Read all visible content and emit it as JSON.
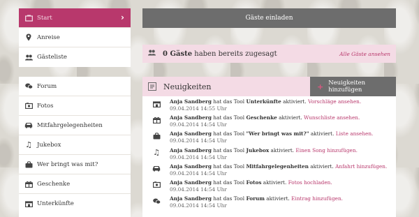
{
  "sidebar_top": [
    {
      "label": "Start",
      "icon": "home-icon",
      "active": true
    },
    {
      "label": "Anreise",
      "icon": "map-pin-icon"
    },
    {
      "label": "Gästeliste",
      "icon": "guests-icon"
    }
  ],
  "sidebar_tools": [
    {
      "label": "Forum",
      "icon": "forum-icon",
      "glyph": "💬"
    },
    {
      "label": "Fotos",
      "icon": "photo-icon",
      "glyph": "▭"
    },
    {
      "label": "Mitfahrgelegenheiten",
      "icon": "car-icon",
      "glyph": "🚗"
    },
    {
      "label": "Jukebox",
      "icon": "music-note-icon",
      "glyph": "♫"
    },
    {
      "label": "Wer bringt was mit?",
      "icon": "bag-icon",
      "glyph": "👜"
    },
    {
      "label": "Geschenke",
      "icon": "gift-icon",
      "glyph": "🎁"
    },
    {
      "label": "Unterkünfte",
      "icon": "house-icon",
      "glyph": "⌂"
    }
  ],
  "invite": {
    "label": "Gäste einladen"
  },
  "guests": {
    "count": "0 Gäste",
    "text": " haben bereits zugesagt",
    "link": "Alle Gäste ansehen"
  },
  "news": {
    "title": "Neuigkeiten",
    "add_label": "Neuigkeiten hinzufügen",
    "items": [
      {
        "icon": "house-icon",
        "glyph": "⌂",
        "user": "Anja Sandberg",
        "pre": " hat das Tool ",
        "tool": "Unterkünfte",
        "post": " aktiviert. ",
        "link": "Vorschläge ansehen.",
        "time": "09.04.2014 14:55 Uhr"
      },
      {
        "icon": "gift-icon",
        "glyph": "🎁",
        "user": "Anja Sandberg",
        "pre": " hat das Tool ",
        "tool": "Geschenke",
        "post": " aktiviert. ",
        "link": "Wunschliste ansehen.",
        "time": "09.04.2014 14:54 Uhr"
      },
      {
        "icon": "bag-icon",
        "glyph": "👜",
        "user": "Anja Sandberg",
        "pre": " hat das Tool ",
        "tool": "\"Wer bringt was mit?\"",
        "post": " aktiviert. ",
        "link": "Liste ansehen.",
        "time": "09.04.2014 14:54 Uhr"
      },
      {
        "icon": "music-note-icon",
        "glyph": "♫",
        "user": "Anja Sandberg",
        "pre": " hat das Tool ",
        "tool": "Jukebox",
        "post": " aktiviert. ",
        "link": "Einen Song hinzufügen.",
        "time": "09.04.2014 14:54 Uhr"
      },
      {
        "icon": "car-icon",
        "glyph": "🚗",
        "user": "Anja Sandberg",
        "pre": " hat das Tool ",
        "tool": "Mitfahrgelegenheiten",
        "post": " aktiviert. ",
        "link": "Anfahrt hinzufügen.",
        "time": "09.04.2014 14:54 Uhr"
      },
      {
        "icon": "photo-icon",
        "glyph": "▭",
        "user": "Anja Sandberg",
        "pre": " hat das Tool ",
        "tool": "Fotos",
        "post": " aktiviert. ",
        "link": "Fotos hochladen.",
        "time": "09.04.2014 14:54 Uhr"
      },
      {
        "icon": "forum-icon",
        "glyph": "💬",
        "user": "Anja Sandberg",
        "pre": " hat das Tool ",
        "tool": "Forum",
        "post": " aktiviert. ",
        "link": "Eintrag hinzufügen.",
        "time": "09.04.2014 14:54 Uhr"
      }
    ]
  },
  "colors": {
    "accent": "#b8386c",
    "bar": "#6d6d6d",
    "pink_bg": "#f4dbe5"
  }
}
